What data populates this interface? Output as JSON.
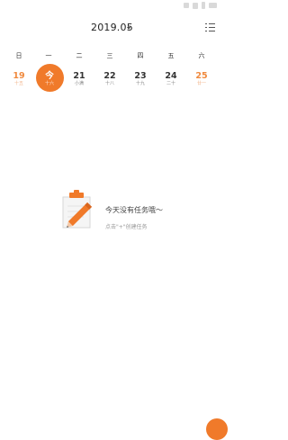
{
  "header": {
    "month": "2019.05"
  },
  "weekdays": [
    "日",
    "一",
    "二",
    "三",
    "四",
    "五",
    "六"
  ],
  "dates": [
    {
      "day": "19",
      "sub": "十五"
    },
    {
      "day": "今",
      "sub": "十六"
    },
    {
      "day": "21",
      "sub": "小满"
    },
    {
      "day": "22",
      "sub": "十八"
    },
    {
      "day": "23",
      "sub": "十九"
    },
    {
      "day": "24",
      "sub": "二十"
    },
    {
      "day": "25",
      "sub": "廿一"
    }
  ],
  "empty": {
    "title": "今天没有任务哦～",
    "hint": "点击\"+\"创建任务"
  },
  "colors": {
    "accent": "#f07a2a",
    "weekend": "#f08a3e"
  },
  "icons": {
    "menu": "list-menu-icon",
    "dropdown": "caret-down-icon",
    "illustration": "clipboard-pencil-icon"
  }
}
